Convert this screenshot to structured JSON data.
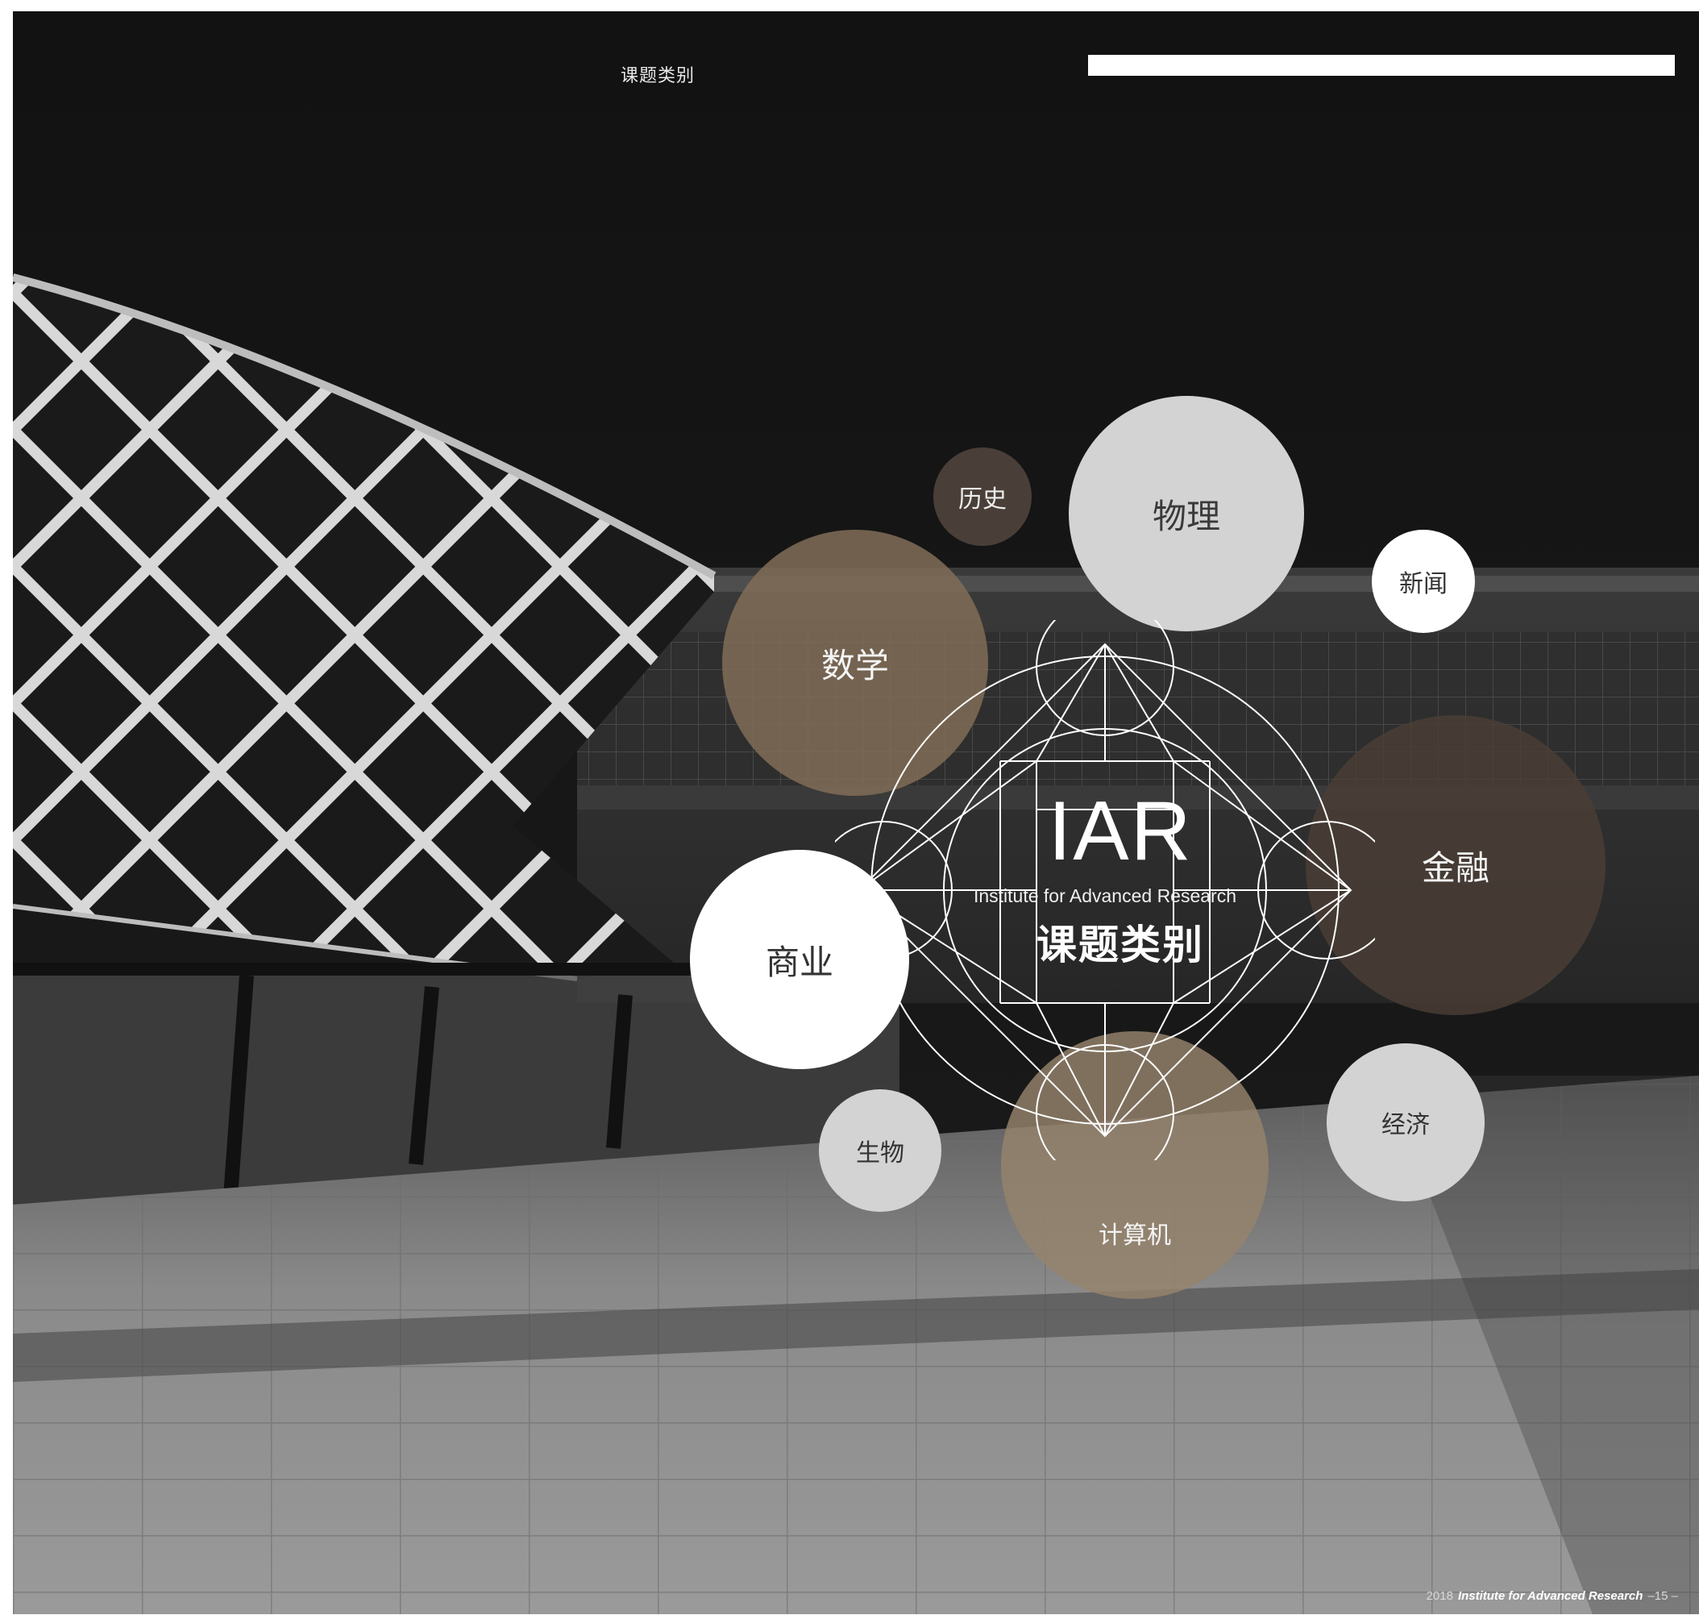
{
  "header": {
    "title": "课题类别"
  },
  "emblem": {
    "acronym": "IAR",
    "full_name": "Institute for Advanced Research",
    "subtitle": "课题类别"
  },
  "categories": [
    {
      "key": "history",
      "label": "历史"
    },
    {
      "key": "physics",
      "label": "物理"
    },
    {
      "key": "news",
      "label": "新闻"
    },
    {
      "key": "math",
      "label": "数学"
    },
    {
      "key": "finance",
      "label": "金融"
    },
    {
      "key": "business",
      "label": "商业"
    },
    {
      "key": "biology",
      "label": "生物"
    },
    {
      "key": "computer",
      "label": "计算机"
    },
    {
      "key": "economics",
      "label": "经济"
    }
  ],
  "footer": {
    "year": "2018",
    "brand": "Institute for Advanced Research",
    "page": "–15 –"
  },
  "colors": {
    "background": "#141414",
    "bubble_gray": "#d4d3d3",
    "bubble_tan": "#806c56",
    "bubble_dark_brown": "#4a3e36",
    "bubble_white": "#ffffff"
  }
}
